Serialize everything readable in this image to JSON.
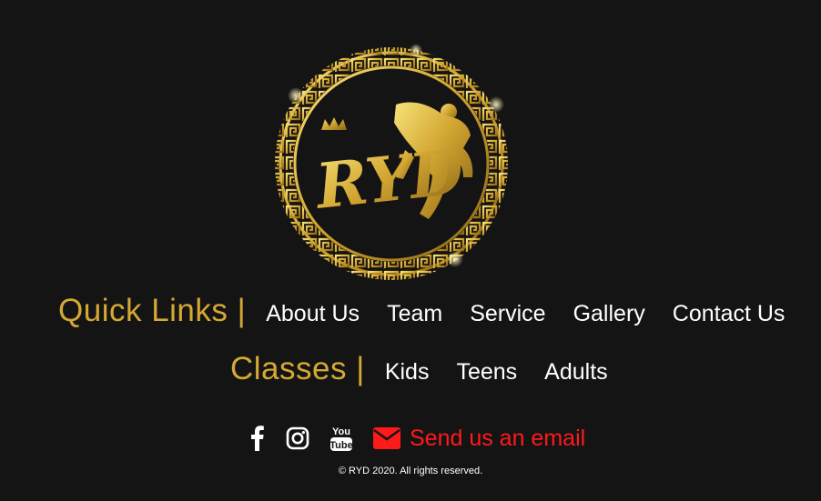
{
  "logo": {
    "brand_text": "RYD",
    "gold_color": "#d4a833"
  },
  "quick_links": {
    "heading": "Quick Links |",
    "items": [
      {
        "label": "About Us"
      },
      {
        "label": "Team"
      },
      {
        "label": "Service"
      },
      {
        "label": "Gallery"
      },
      {
        "label": "Contact Us"
      }
    ]
  },
  "classes": {
    "heading": "Classes |",
    "items": [
      {
        "label": "Kids"
      },
      {
        "label": "Teens"
      },
      {
        "label": "Adults"
      }
    ]
  },
  "social": {
    "icons": [
      "facebook-icon",
      "instagram-icon",
      "youtube-icon"
    ],
    "youtube_text_top": "You",
    "youtube_text_bottom": "Tube",
    "email_label": "Send us an email",
    "email_color": "#ff1a1a"
  },
  "footer": {
    "copyright": "© RYD 2020. All rights reserved."
  },
  "colors": {
    "background": "#151414",
    "accent_gold": "#d4a833",
    "link_white": "#ffffff",
    "email_red": "#ff1a1a"
  }
}
